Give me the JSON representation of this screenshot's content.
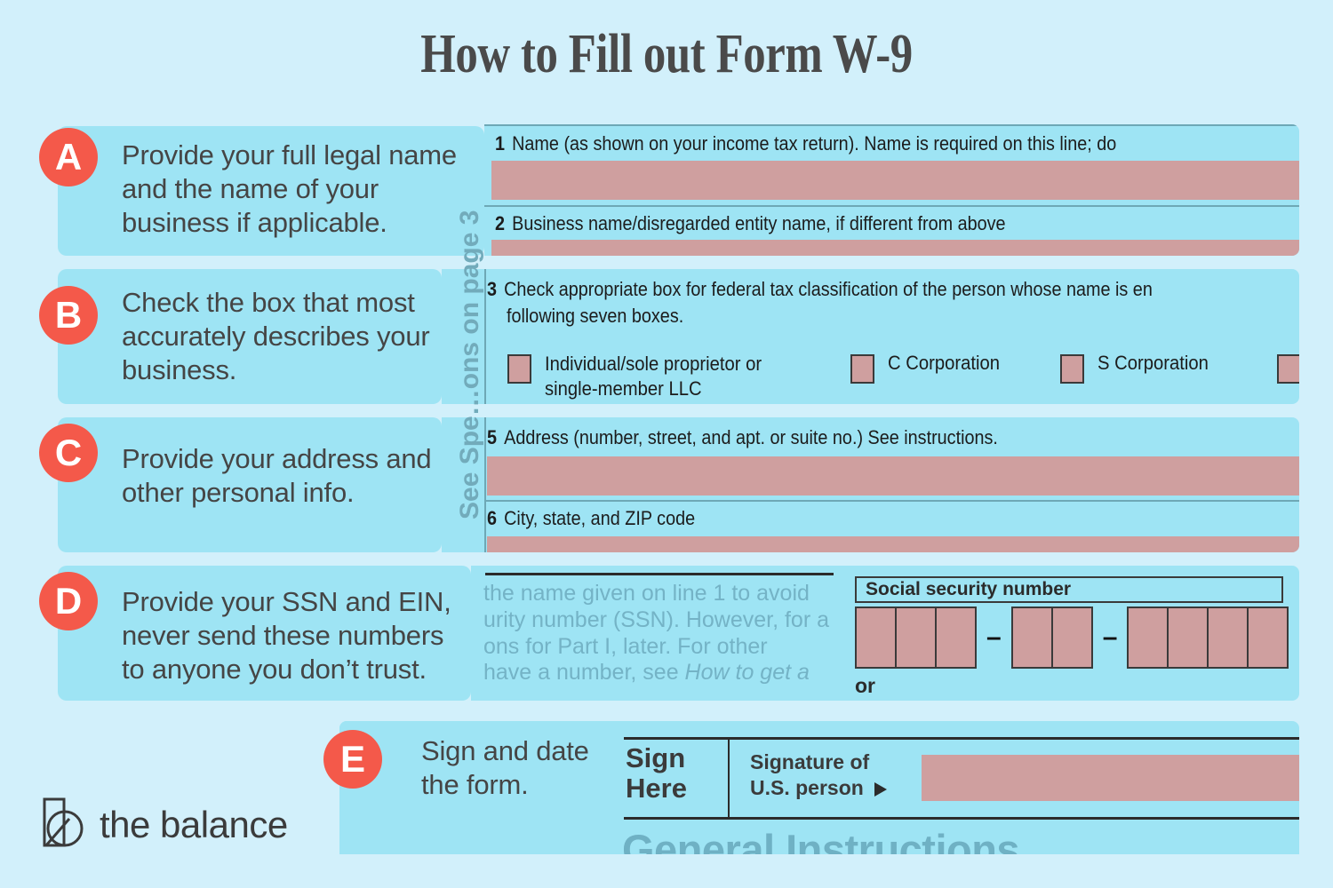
{
  "page": {
    "title": "How to Fill out Form W-9",
    "background_color": "#d2f0fb",
    "card_color": "#9ee4f4",
    "badge_color": "#f4594a",
    "fill_color": "#cf9f9f"
  },
  "brand": {
    "name": "the balance",
    "logo_icon": "balance-b-mark-icon"
  },
  "steps": [
    {
      "letter": "A",
      "text": "Provide your full legal name and the name of your business if applicable."
    },
    {
      "letter": "B",
      "text": "Check the box that most accurately describes your business."
    },
    {
      "letter": "C",
      "text": "Provide your address and other personal info."
    },
    {
      "letter": "D",
      "text": "Provide your SSN and EIN, never send these numbers to anyone you don’t trust."
    },
    {
      "letter": "E",
      "text": "Sign and date the form."
    }
  ],
  "form": {
    "side_label": "See Spe…ons on page 3",
    "line1": {
      "number": "1",
      "label": "Name (as shown on your income tax return). Name is required on this line; do"
    },
    "line2": {
      "number": "2",
      "label": "Business name/disregarded entity name, if different from above"
    },
    "line3": {
      "number": "3",
      "label_line1": "Check appropriate box for federal tax classification of the person whose name is en",
      "label_line2": "following seven boxes."
    },
    "classification_boxes": [
      "Individual/sole proprietor or single-member LLC",
      "C Corporation",
      "S Corporation",
      ""
    ],
    "line5": {
      "number": "5",
      "label": "Address (number, street, and apt. or suite no.) See instructions."
    },
    "line6": {
      "number": "6",
      "label": "City, state, and ZIP code"
    },
    "part1": {
      "ghost_lines": [
        "the name given on line 1 to avoid",
        "urity number (SSN). However, for a",
        "ons for Part I, later. For other",
        "have a number, see "
      ],
      "ghost_italic_tail": "How to get a",
      "ssn_title": "Social security number",
      "ssn_groups": [
        3,
        2,
        4
      ],
      "ssn_separator": "–",
      "or_label": "or"
    },
    "signature": {
      "sign_here_line1": "Sign",
      "sign_here_line2": "Here",
      "signature_label_line1": "Signature of",
      "signature_label_line2": "U.S. person",
      "arrow_icon": "right-triangle-icon"
    },
    "general_instructions": "General Instructions"
  }
}
